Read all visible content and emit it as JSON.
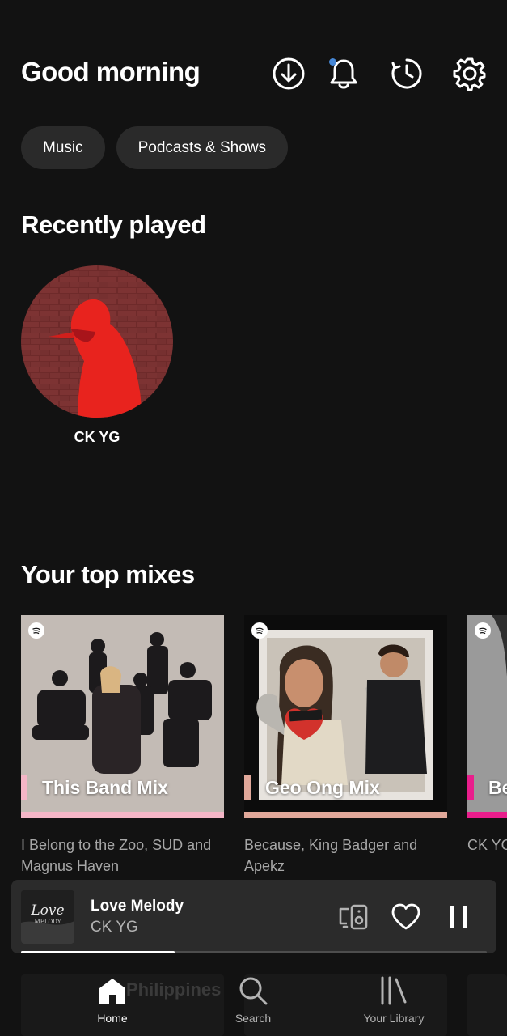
{
  "header": {
    "greeting": "Good morning"
  },
  "chips": [
    {
      "label": "Music"
    },
    {
      "label": "Podcasts & Shows"
    }
  ],
  "recently_played": {
    "title": "Recently played",
    "items": [
      {
        "name": "CK YG"
      }
    ]
  },
  "top_mixes": {
    "title": "Your top mixes",
    "items": [
      {
        "label": "This Band Mix",
        "description": "I Belong to the Zoo, SUD and Magnus Haven",
        "accent": "#f4b6c7"
      },
      {
        "label": "Geo Ong Mix",
        "description": "Because, King Badger and Apekz",
        "accent": "#e1a89a"
      },
      {
        "label": "Be",
        "description": "CK YG and T",
        "accent": "#e91e8c"
      }
    ]
  },
  "mini_player": {
    "title": "Love Melody",
    "artist": "CK YG",
    "progress": 0.33
  },
  "bottom_nav": {
    "background_text": "Philippines",
    "items": [
      {
        "label": "Home"
      },
      {
        "label": "Search"
      },
      {
        "label": "Your Library"
      }
    ]
  },
  "colors": {
    "background": "#121212",
    "chip": "#2a2a2a",
    "player": "#2b2b2b",
    "notification_dot": "#4687d6"
  }
}
